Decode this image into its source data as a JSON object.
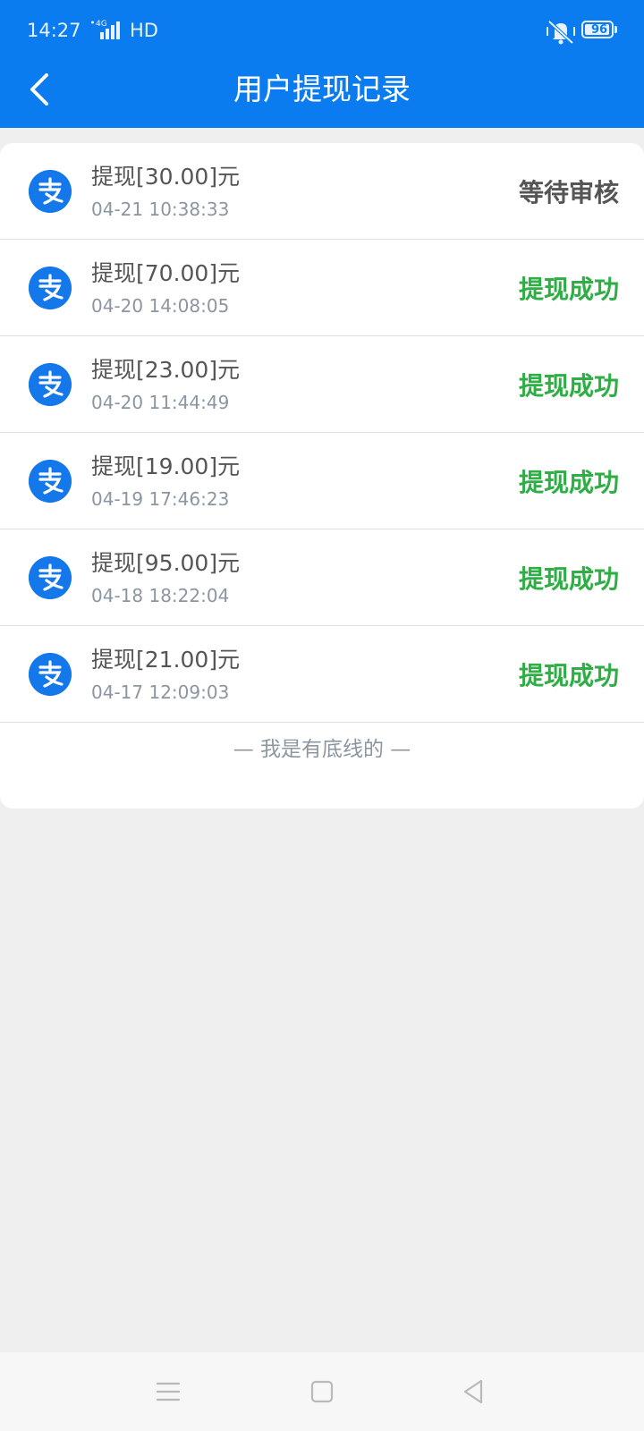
{
  "status_bar": {
    "time": "14:27",
    "network": "HD",
    "network_badge": "4G",
    "battery": "96",
    "battery_level_percent": 96
  },
  "header": {
    "title": "用户提现记录",
    "back_icon": "chevron-left-icon"
  },
  "colors": {
    "brand_blue": "#0b7cf0",
    "pending": "#555555",
    "success": "#2fae46"
  },
  "records": [
    {
      "amount": "提现[30.00]元",
      "date": "04-21 10:38:33",
      "status": "等待审核",
      "status_type": "pending"
    },
    {
      "amount": "提现[70.00]元",
      "date": "04-20 14:08:05",
      "status": "提现成功",
      "status_type": "success"
    },
    {
      "amount": "提现[23.00]元",
      "date": "04-20 11:44:49",
      "status": "提现成功",
      "status_type": "success"
    },
    {
      "amount": "提现[19.00]元",
      "date": "04-19 17:46:23",
      "status": "提现成功",
      "status_type": "success"
    },
    {
      "amount": "提现[95.00]元",
      "date": "04-18 18:22:04",
      "status": "提现成功",
      "status_type": "success"
    },
    {
      "amount": "提现[21.00]元",
      "date": "04-17 12:09:03",
      "status": "提现成功",
      "status_type": "success"
    }
  ],
  "footer_note": "— 我是有底线的 —",
  "navigation": {
    "menu_icon": "menu-icon",
    "home_icon": "home-square-icon",
    "back_icon": "back-triangle-icon"
  }
}
